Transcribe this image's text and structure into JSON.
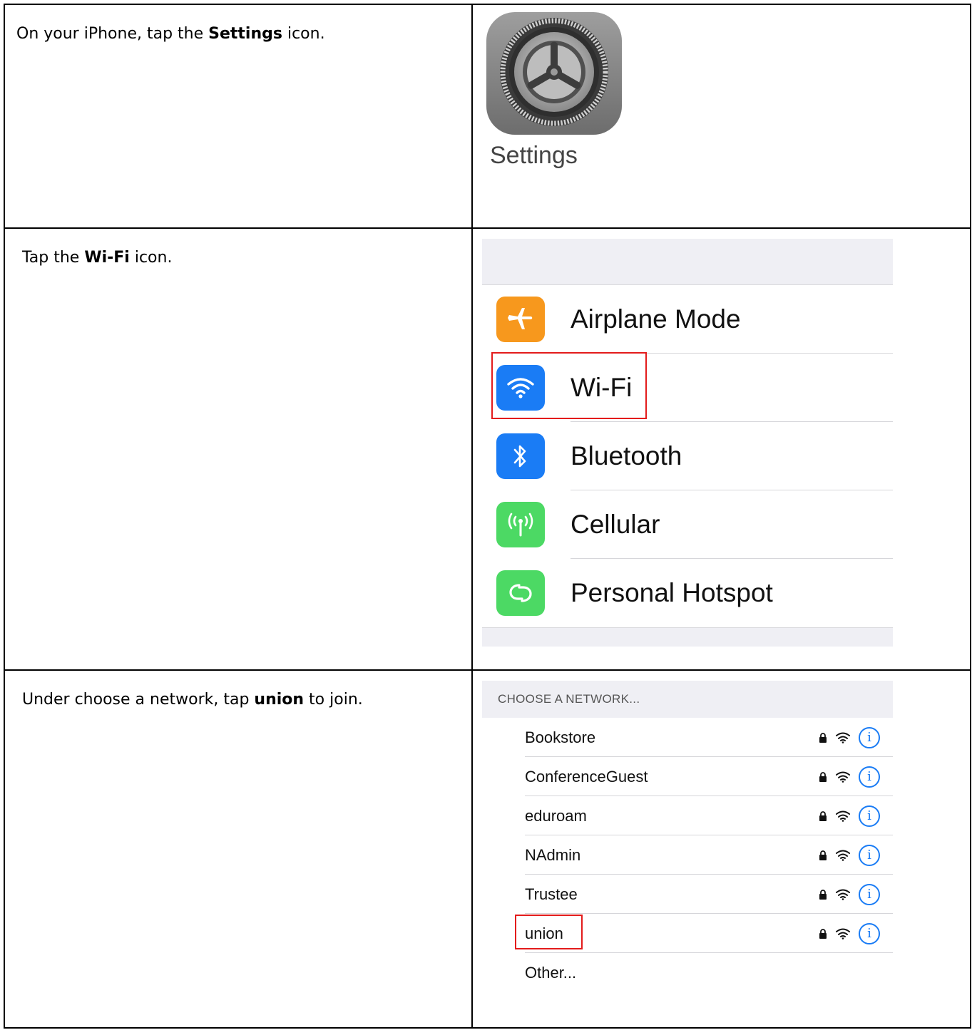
{
  "steps": [
    {
      "instruction": {
        "pre": "On your iPhone, tap the ",
        "bold": "Settings",
        "post": " icon."
      },
      "settings_icon": {
        "label": "Settings",
        "icon": "gear-icon"
      }
    },
    {
      "instruction": {
        "pre": "Tap the ",
        "bold": "Wi-Fi",
        "post": " icon."
      },
      "settings_list": [
        {
          "label": "Airplane Mode",
          "icon": "airplane-icon",
          "color": "#f7981d"
        },
        {
          "label": "Wi-Fi",
          "icon": "wifi-icon",
          "color": "#1a7cf5",
          "highlighted": true
        },
        {
          "label": "Bluetooth",
          "icon": "bluetooth-icon",
          "color": "#1a7cf5"
        },
        {
          "label": "Cellular",
          "icon": "antenna-icon",
          "color": "#4cd964"
        },
        {
          "label": "Personal Hotspot",
          "icon": "hotspot-icon",
          "color": "#4cd964"
        }
      ]
    },
    {
      "instruction": {
        "pre": "Under choose a network, tap ",
        "bold": "union",
        "post": " to join."
      },
      "network_header": "CHOOSE A NETWORK...",
      "networks": [
        {
          "name": "Bookstore",
          "secured": true
        },
        {
          "name": "ConferenceGuest",
          "secured": true
        },
        {
          "name": "eduroam",
          "secured": true
        },
        {
          "name": "NAdmin",
          "secured": true
        },
        {
          "name": "Trustee",
          "secured": true
        },
        {
          "name": "union",
          "secured": true,
          "highlighted": true
        },
        {
          "name": "Other...",
          "secured": false
        }
      ]
    }
  ],
  "colors": {
    "highlight": "#e31b1b",
    "ios_blue": "#1a7cf5",
    "ios_green": "#4cd964",
    "ios_orange": "#f7981d",
    "group_bg": "#efeff4"
  }
}
